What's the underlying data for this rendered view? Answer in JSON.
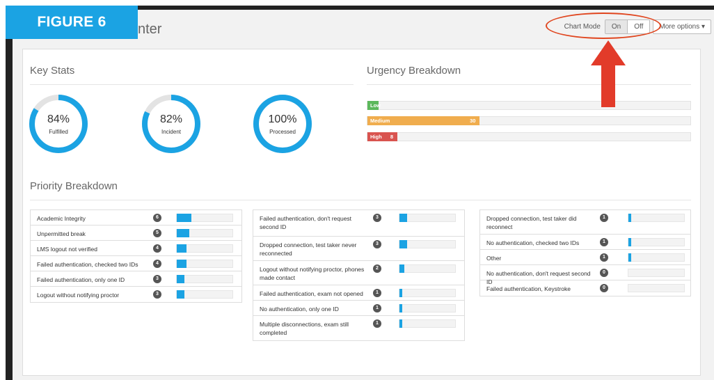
{
  "figure_label": "FIGURE 6",
  "page_title": "nter",
  "toolbar": {
    "chart_mode_label": "Chart Mode",
    "on_label": "On",
    "off_label": "Off",
    "more_options_label": "More options ▾"
  },
  "key_stats": {
    "title": "Key Stats",
    "items": [
      {
        "value": "84%",
        "label": "Fulfilled",
        "fraction": 0.84
      },
      {
        "value": "82%",
        "label": "Incident",
        "fraction": 0.82
      },
      {
        "value": "100%",
        "label": "Processed",
        "fraction": 1.0
      }
    ]
  },
  "urgency": {
    "title": "Urgency Breakdown",
    "max": 100,
    "bars": [
      {
        "label": "Low",
        "count": "3",
        "value": 3,
        "color": "#5cb85c"
      },
      {
        "label": "Medium",
        "count": "30",
        "value": 30,
        "color": "#f0ad4e"
      },
      {
        "label": "High",
        "count": "8",
        "value": 8,
        "color": "#d9534f"
      }
    ]
  },
  "priority": {
    "title": "Priority Breakdown",
    "max": 30,
    "columns": [
      [
        {
          "label": "Academic Integrity",
          "count": "6",
          "value": 6
        },
        {
          "label": "Unpermitted break",
          "count": "5",
          "value": 5
        },
        {
          "label": "LMS logout not verified",
          "count": "4",
          "value": 4
        },
        {
          "label": "Failed authentication, checked two IDs",
          "count": "4",
          "value": 4
        },
        {
          "label": "Failed authentication, only one ID",
          "count": "3",
          "value": 3
        },
        {
          "label": "Logout without notifying proctor",
          "count": "3",
          "value": 3
        }
      ],
      [
        {
          "label": "Failed authentication, don't request second ID",
          "count": "3",
          "value": 3
        },
        {
          "label": "Dropped connection, test taker never reconnected",
          "count": "3",
          "value": 3
        },
        {
          "label": "Logout without notifying proctor, phones made contact",
          "count": "2",
          "value": 2
        },
        {
          "label": "Failed authentication, exam not opened",
          "count": "1",
          "value": 1
        },
        {
          "label": "No authentication, only one ID",
          "count": "1",
          "value": 1
        },
        {
          "label": "Multiple disconnections, exam still completed",
          "count": "1",
          "value": 1
        }
      ],
      [
        {
          "label": "Dropped connection, test taker did reconnect",
          "count": "1",
          "value": 1
        },
        {
          "label": "No authentication, checked two IDs",
          "count": "1",
          "value": 1
        },
        {
          "label": "Other",
          "count": "1",
          "value": 1
        },
        {
          "label": "No authentication, don't request second ID",
          "count": "0",
          "value": 0
        },
        {
          "label": "Failed authentication, Keystroke",
          "count": "0",
          "value": 0
        }
      ]
    ]
  }
}
